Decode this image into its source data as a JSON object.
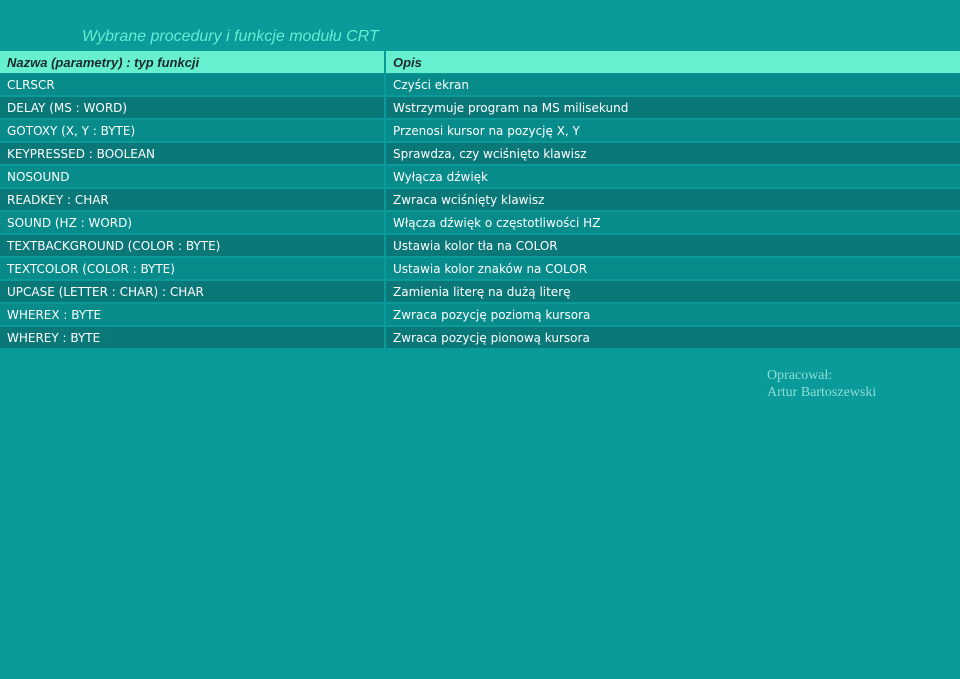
{
  "title": "Wybrane procedury i funkcje modułu CRT",
  "table": {
    "headers": [
      "Nazwa (parametry) : typ funkcji",
      "Opis"
    ],
    "rows": [
      [
        "CLRSCR",
        "Czyści ekran"
      ],
      [
        "DELAY (MS : WORD)",
        "Wstrzymuje program na MS milisekund"
      ],
      [
        "GOTOXY (X, Y : BYTE)",
        "Przenosi kursor na pozycję X, Y"
      ],
      [
        "KEYPRESSED : BOOLEAN",
        "Sprawdza, czy wciśnięto klawisz"
      ],
      [
        "NOSOUND",
        "Wyłącza dźwięk"
      ],
      [
        "READKEY : CHAR",
        "Zwraca wciśnięty klawisz"
      ],
      [
        "SOUND (HZ : WORD)",
        "Włącza dźwięk o częstotliwości HZ"
      ],
      [
        "TEXTBACKGROUND (COLOR : BYTE)",
        "Ustawia kolor tła na COLOR"
      ],
      [
        "TEXTCOLOR (COLOR : BYTE)",
        "Ustawia kolor znaków na COLOR"
      ],
      [
        "UPCASE (LETTER : CHAR) : CHAR",
        "Zamienia literę na dużą literę"
      ],
      [
        "WHEREX : BYTE",
        "Zwraca pozycję poziomą kursora"
      ],
      [
        "WHEREY : BYTE",
        "Zwraca pozycję pionową kursora"
      ]
    ]
  },
  "author": {
    "label": "Opracował:",
    "name": "Artur Bartoszewski"
  },
  "colors": {
    "background": "#0a9a9a",
    "header": "#66f0cf",
    "title": "#5ff0cf",
    "row_light": "#078b8b",
    "row_dark": "#0a7878"
  }
}
